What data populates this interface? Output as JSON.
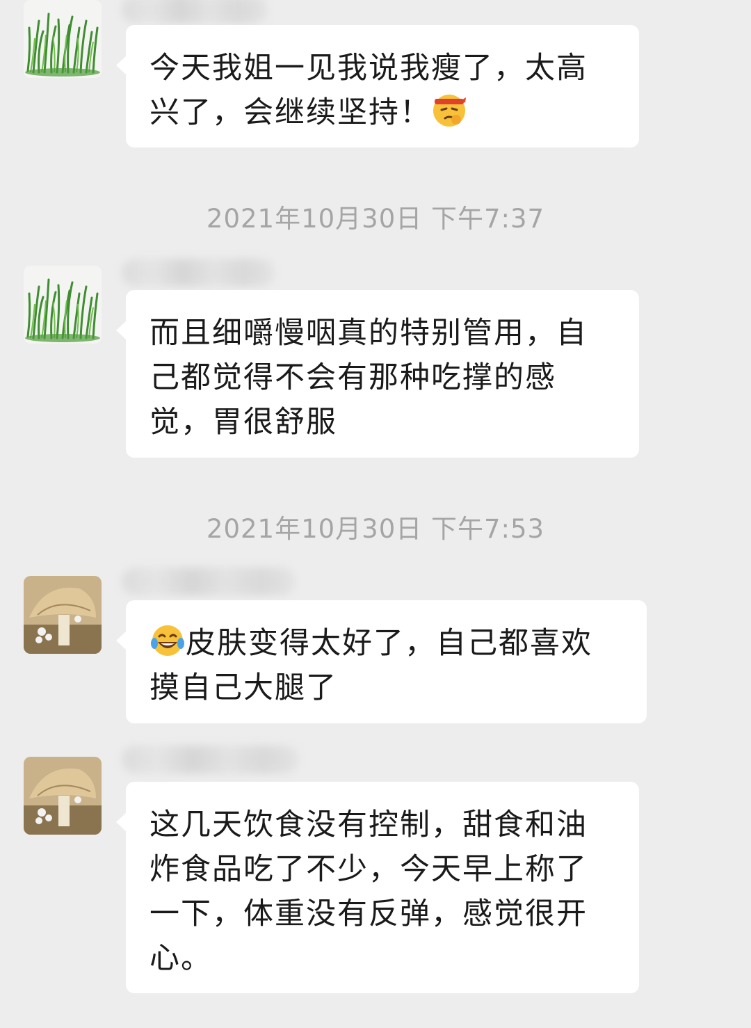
{
  "messages": [
    {
      "sender_avatar": "grass-avatar",
      "text_before_emoji": "今天我姐一见我说我瘦了，太高兴了，会继续坚持！",
      "emoji": "determined-face-emoji"
    },
    {
      "sender_avatar": "grass-avatar",
      "text": "而且细嚼慢咽真的特别管用，自己都觉得不会有那种吃撑的感觉，胃很舒服"
    },
    {
      "sender_avatar": "mushroom-avatar",
      "emoji": "tears-of-joy-emoji",
      "text_after_emoji": "皮肤变得太好了，自己都喜欢摸自己大腿了"
    },
    {
      "sender_avatar": "mushroom-avatar",
      "text": "这几天饮食没有控制，甜食和油炸食品吃了不少，今天早上称了一下，体重没有反弹，感觉很开心。"
    }
  ],
  "timestamps": [
    "2021年10月30日 下午7:37",
    "2021年10月30日 下午7:53"
  ]
}
